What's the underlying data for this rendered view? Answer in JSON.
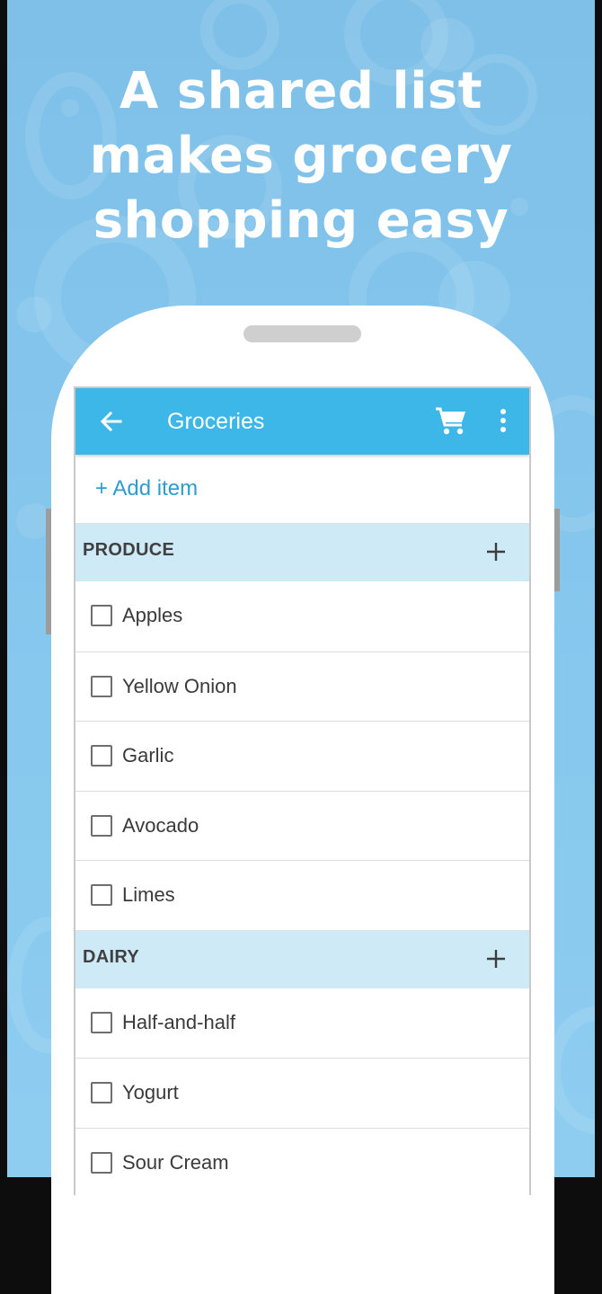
{
  "marketing": {
    "headline_line1": "A shared list",
    "headline_line2": "makes grocery",
    "headline_line3": "shopping easy"
  },
  "app_bar": {
    "title": "Groceries",
    "back_icon": "arrow-left-icon",
    "cart_icon": "shopping-cart-icon",
    "menu_icon": "more-vertical-icon",
    "color": "#3db7e7"
  },
  "add_item_label": "+ Add item",
  "sections": [
    {
      "name": "PRODUCE",
      "add_icon": "plus-icon",
      "items": [
        {
          "label": "Apples",
          "checked": false
        },
        {
          "label": "Yellow Onion",
          "checked": false
        },
        {
          "label": "Garlic",
          "checked": false
        },
        {
          "label": "Avocado",
          "checked": false
        },
        {
          "label": "Limes",
          "checked": false
        }
      ]
    },
    {
      "name": "DAIRY",
      "add_icon": "plus-icon",
      "items": [
        {
          "label": "Half-and-half",
          "checked": false
        },
        {
          "label": "Yogurt",
          "checked": false
        },
        {
          "label": "Sour Cream",
          "checked": false
        }
      ]
    }
  ],
  "colors": {
    "background": "#86c8ee",
    "section_header": "#ceeaf7",
    "link": "#2f9ccc"
  }
}
